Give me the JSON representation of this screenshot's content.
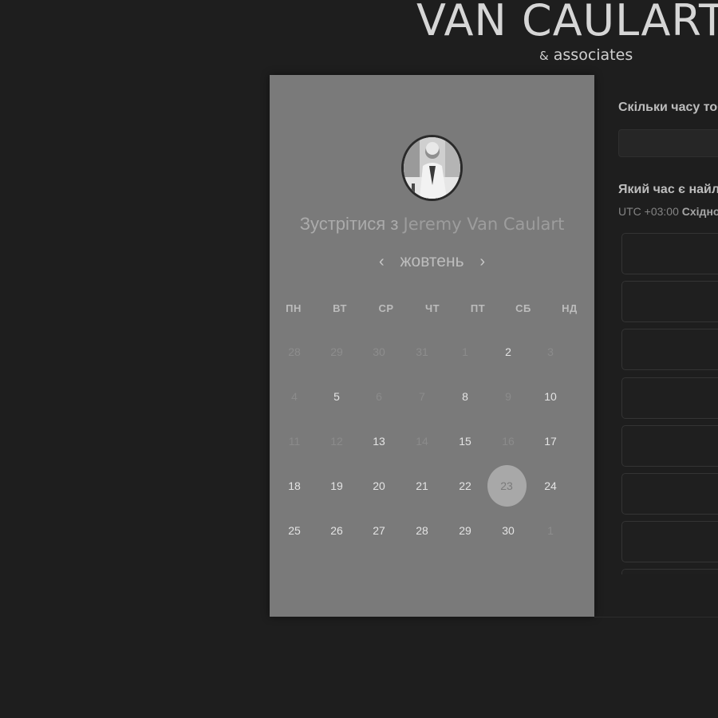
{
  "brand": {
    "name": "VAN CAULART",
    "sub_amp": "&",
    "sub_text": "associates"
  },
  "card": {
    "meet_prefix": "Зустрітися з",
    "meet_name": "Jeremy Van Caulart",
    "month": "жовтень",
    "prev_icon": "‹",
    "next_icon": "›",
    "weekdays": [
      "ПН",
      "ВТ",
      "СР",
      "ЧТ",
      "ПТ",
      "СБ",
      "НД"
    ],
    "weeks": [
      [
        "28",
        "29",
        "30",
        "31",
        "1",
        "2",
        "3"
      ],
      [
        "4",
        "5",
        "6",
        "7",
        "8",
        "9",
        "10"
      ],
      [
        "11",
        "12",
        "13",
        "14",
        "15",
        "16",
        "17"
      ],
      [
        "18",
        "19",
        "20",
        "21",
        "22",
        "23",
        "24"
      ],
      [
        "25",
        "26",
        "27",
        "28",
        "29",
        "30",
        "1"
      ]
    ],
    "selected_day": "23"
  },
  "booking": {
    "duration_question": "Скільки часу тоб",
    "time_question": "Який час є найлі",
    "timezone_offset": "UTC +03:00",
    "timezone_name": "Східно"
  },
  "colors": {
    "background": "#1e1e1e",
    "card": "#7a7a7a",
    "selected_circle": "#a8a8a8"
  }
}
